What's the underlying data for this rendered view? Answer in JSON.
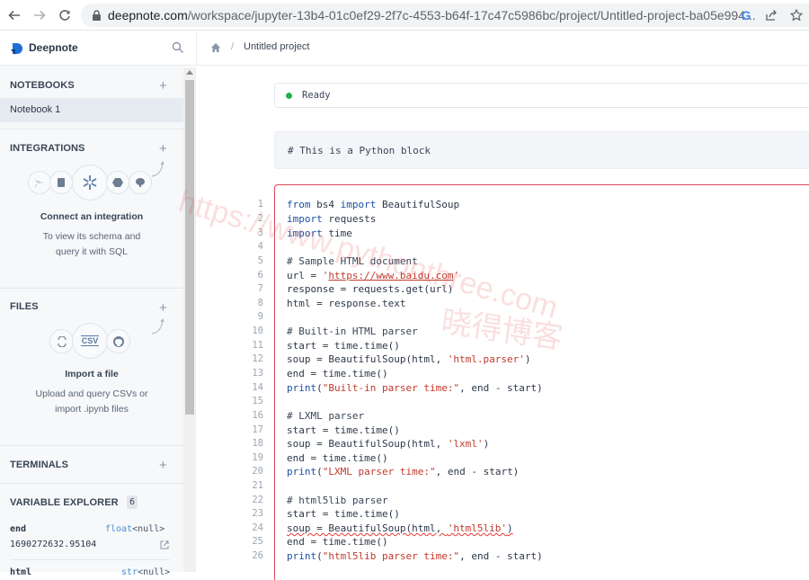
{
  "browser": {
    "url_host": "deepnote.com",
    "url_path": "/workspace/jupyter-13b4-01c0ef29-2f7c-4553-b64f-17c47c5986bc/project/Untitled-project-ba05e994..."
  },
  "app": {
    "brand": "Deepnote"
  },
  "breadcrumb": {
    "separator": "/",
    "project": "Untitled project"
  },
  "sidebar": {
    "notebooks": {
      "title": "NOTEBOOKS",
      "items": [
        {
          "label": "Notebook 1"
        }
      ]
    },
    "integrations": {
      "title": "INTEGRATIONS",
      "empty_title": "Connect an integration",
      "empty_desc_1": "To view its schema and",
      "empty_desc_2": "query it with SQL",
      "icons": [
        "segment-icon",
        "redshift-icon",
        "snowflake-icon",
        "bigquery-icon",
        "postgres-icon"
      ]
    },
    "files": {
      "title": "FILES",
      "empty_title": "Import a file",
      "empty_desc_1": "Upload and query CSVs or",
      "empty_desc_2": "import .ipynb files",
      "csv_label": "CSV"
    },
    "terminals": {
      "title": "TERMINALS"
    },
    "variable_explorer": {
      "title": "VARIABLE EXPLORER",
      "count": "6",
      "variables": [
        {
          "name": "end",
          "type": "float",
          "shape": "<null>",
          "value": "1690272632.95104"
        },
        {
          "name": "html",
          "type": "str",
          "shape": "<null>",
          "value": ""
        }
      ]
    }
  },
  "main": {
    "status": "Ready",
    "status_color": "#22b14c",
    "markdown_block": "# This is a Python block",
    "code_accent": "#d9475a",
    "code_lines": [
      {
        "n": "1"
      },
      {
        "n": "2"
      },
      {
        "n": "3"
      },
      {
        "n": "4"
      },
      {
        "n": "5"
      },
      {
        "n": "6"
      },
      {
        "n": "7"
      },
      {
        "n": "8"
      },
      {
        "n": "9"
      },
      {
        "n": "10"
      },
      {
        "n": "11"
      },
      {
        "n": "12"
      },
      {
        "n": "13"
      },
      {
        "n": "14"
      },
      {
        "n": "15"
      },
      {
        "n": "16"
      },
      {
        "n": "17"
      },
      {
        "n": "18"
      },
      {
        "n": "19"
      },
      {
        "n": "20"
      },
      {
        "n": "21"
      },
      {
        "n": "22"
      },
      {
        "n": "23"
      },
      {
        "n": "24"
      },
      {
        "n": "25"
      },
      {
        "n": "26"
      }
    ],
    "code": {
      "l1_kw1": "from",
      "l1_mod": " bs4 ",
      "l1_kw2": "import",
      "l1_rest": " BeautifulSoup",
      "l2_kw": "import",
      "l2_rest": " requests",
      "l3_kw": "import",
      "l3_rest": " time",
      "l5": "# Sample HTML document",
      "l6_pre": "url = ",
      "l6_q1": "'",
      "l6_url": "https://www.baidu.com",
      "l6_q2": "'",
      "l7": "response = requests.get(url)",
      "l8": "html = response.text",
      "l10": "# Built-in HTML parser",
      "l11": "start = time.time()",
      "l12_pre": "soup = BeautifulSoup(html, ",
      "l12_str": "'html.parser'",
      "l12_post": ")",
      "l13": "end = time.time()",
      "l14_fn": "print",
      "l14_open": "(",
      "l14_str": "\"Built-in parser time:\"",
      "l14_post": ", end - start)",
      "l16": "# LXML parser",
      "l17": "start = time.time()",
      "l18_pre": "soup = BeautifulSoup(html, ",
      "l18_str": "'lxml'",
      "l18_post": ")",
      "l19": "end = time.time()",
      "l20_fn": "print",
      "l20_open": "(",
      "l20_str": "\"LXML parser time:\"",
      "l20_post": ", end - start)",
      "l22": "# html5lib parser",
      "l23": "start = time.time()",
      "l24_pre": "soup = BeautifulSoup(html, ",
      "l24_str": "'html5lib'",
      "l24_post": ")",
      "l25": "end = time.time()",
      "l26_fn": "print",
      "l26_open": "(",
      "l26_str": "\"html5lib parser time:\"",
      "l26_post": ", end - start)"
    }
  },
  "watermark": {
    "line1": "https://www.pythonthree.com",
    "line2": "晓得博客"
  }
}
